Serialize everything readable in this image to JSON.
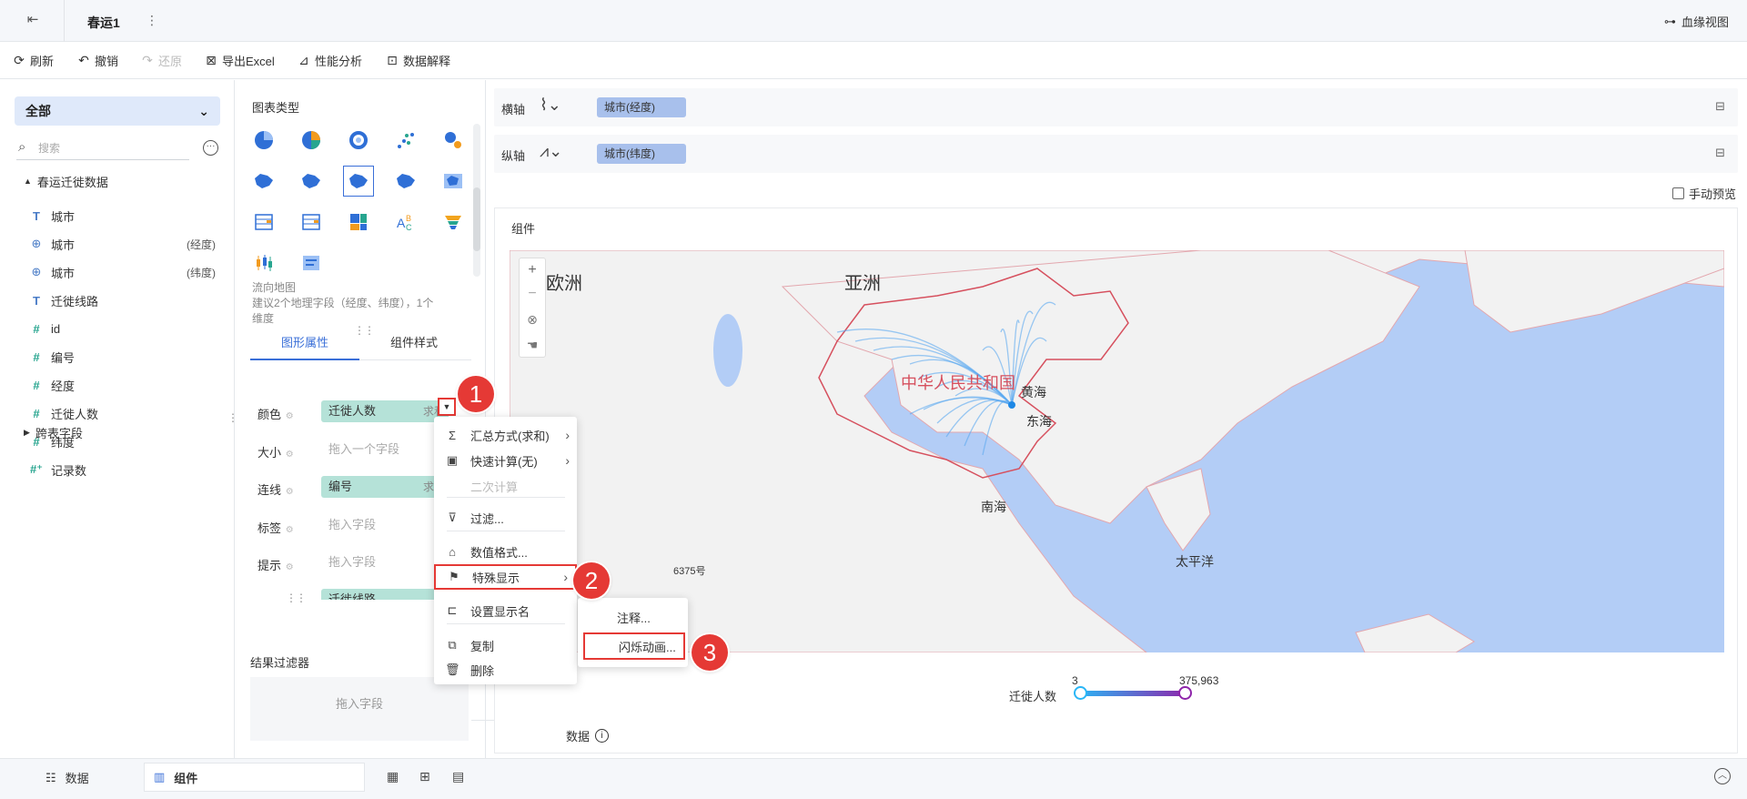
{
  "titlebar": {
    "tab_title": "春运1",
    "more": "⋮",
    "lineage_label": "血缘视图"
  },
  "toolbar": {
    "refresh": "刷新",
    "undo": "撤销",
    "redo": "还原",
    "export": "导出Excel",
    "perf": "性能分析",
    "explain": "数据解释"
  },
  "left": {
    "dataset_select": "全部",
    "search_placeholder": "搜索",
    "tree_root": "春运迁徙数据",
    "fields": [
      {
        "icon": "text",
        "label": "城市",
        "suffix": ""
      },
      {
        "icon": "globe",
        "label": "城市",
        "suffix": "(经度)"
      },
      {
        "icon": "globe",
        "label": "城市",
        "suffix": "(纬度)"
      },
      {
        "icon": "text",
        "label": "迁徙线路",
        "suffix": ""
      },
      {
        "icon": "hash",
        "label": "id",
        "suffix": ""
      },
      {
        "icon": "hash",
        "label": "编号",
        "suffix": ""
      },
      {
        "icon": "hash",
        "label": "经度",
        "suffix": ""
      },
      {
        "icon": "hash",
        "label": "迁徙人数",
        "suffix": ""
      },
      {
        "icon": "hash",
        "label": "纬度",
        "suffix": ""
      },
      {
        "icon": "hash-plus",
        "label": "记录数",
        "suffix": ""
      }
    ],
    "cross_table": "跨表字段"
  },
  "middle": {
    "chart_type_title": "图表类型",
    "chart_desc_line1": "流向地图",
    "chart_desc_line2": "建议2个地理字段（经度、纬度），1个",
    "chart_desc_line3": "维度",
    "tab_graphic": "图形属性",
    "tab_style": "组件样式",
    "props": [
      {
        "label": "颜色",
        "field": "迁徙人数",
        "agg": "求和",
        "filled": true
      },
      {
        "label": "大小",
        "field": "拖入一个字段",
        "agg": "",
        "filled": false
      },
      {
        "label": "连线",
        "field": "编号",
        "agg": "求和",
        "filled": true
      },
      {
        "label": "标签",
        "field": "拖入字段",
        "agg": "",
        "filled": false
      },
      {
        "label": "提示",
        "field": "拖入字段",
        "agg": "",
        "filled": false
      }
    ],
    "partial_field": "迁徙线路",
    "result_filter_title": "结果过滤器",
    "result_filter_drop": "拖入字段"
  },
  "axes": {
    "x_label": "横轴",
    "x_field": "城市(经度)",
    "y_label": "纵轴",
    "y_field": "城市(纬度)"
  },
  "preview_label": "手动预览",
  "canvas": {
    "title": "组件",
    "map_labels": {
      "europe": "欧洲",
      "asia": "亚洲",
      "china": "中华人民共和国",
      "yellow_sea": "黄海",
      "east_sea": "东海",
      "south_sea": "南海",
      "pacific": "太平洋",
      "attribution": "6375号"
    },
    "legend": {
      "label": "迁徙人数",
      "min": "3",
      "max": "375,963",
      "start_color": "#29b6f6",
      "end_color": "#8e24aa"
    },
    "data_info": "数据"
  },
  "context_menu": {
    "items": [
      {
        "label": "汇总方式(求和)",
        "arrow": true,
        "disabled": false
      },
      {
        "label": "快速计算(无)",
        "arrow": true,
        "disabled": false
      },
      {
        "label": "二次计算",
        "arrow": false,
        "disabled": true
      },
      {
        "label": "过滤...",
        "arrow": false,
        "disabled": false
      },
      {
        "label": "数值格式...",
        "arrow": false,
        "disabled": false
      },
      {
        "label": "特殊显示",
        "arrow": true,
        "disabled": false
      },
      {
        "label": "设置显示名",
        "arrow": false,
        "disabled": false
      },
      {
        "label": "复制",
        "arrow": false,
        "disabled": false
      },
      {
        "label": "删除",
        "arrow": false,
        "disabled": false
      }
    ],
    "submenu": {
      "note": "注释...",
      "blink": "闪烁动画..."
    }
  },
  "badges": {
    "one": "1",
    "two": "2",
    "three": "3"
  },
  "bottom": {
    "data_tab": "数据",
    "component_tab": "组件"
  },
  "colors": {
    "accent": "#3a6fd8",
    "highlight": "#e53935",
    "map_sea": "#b3cdf6",
    "flow_line": "#5aa9f0"
  }
}
